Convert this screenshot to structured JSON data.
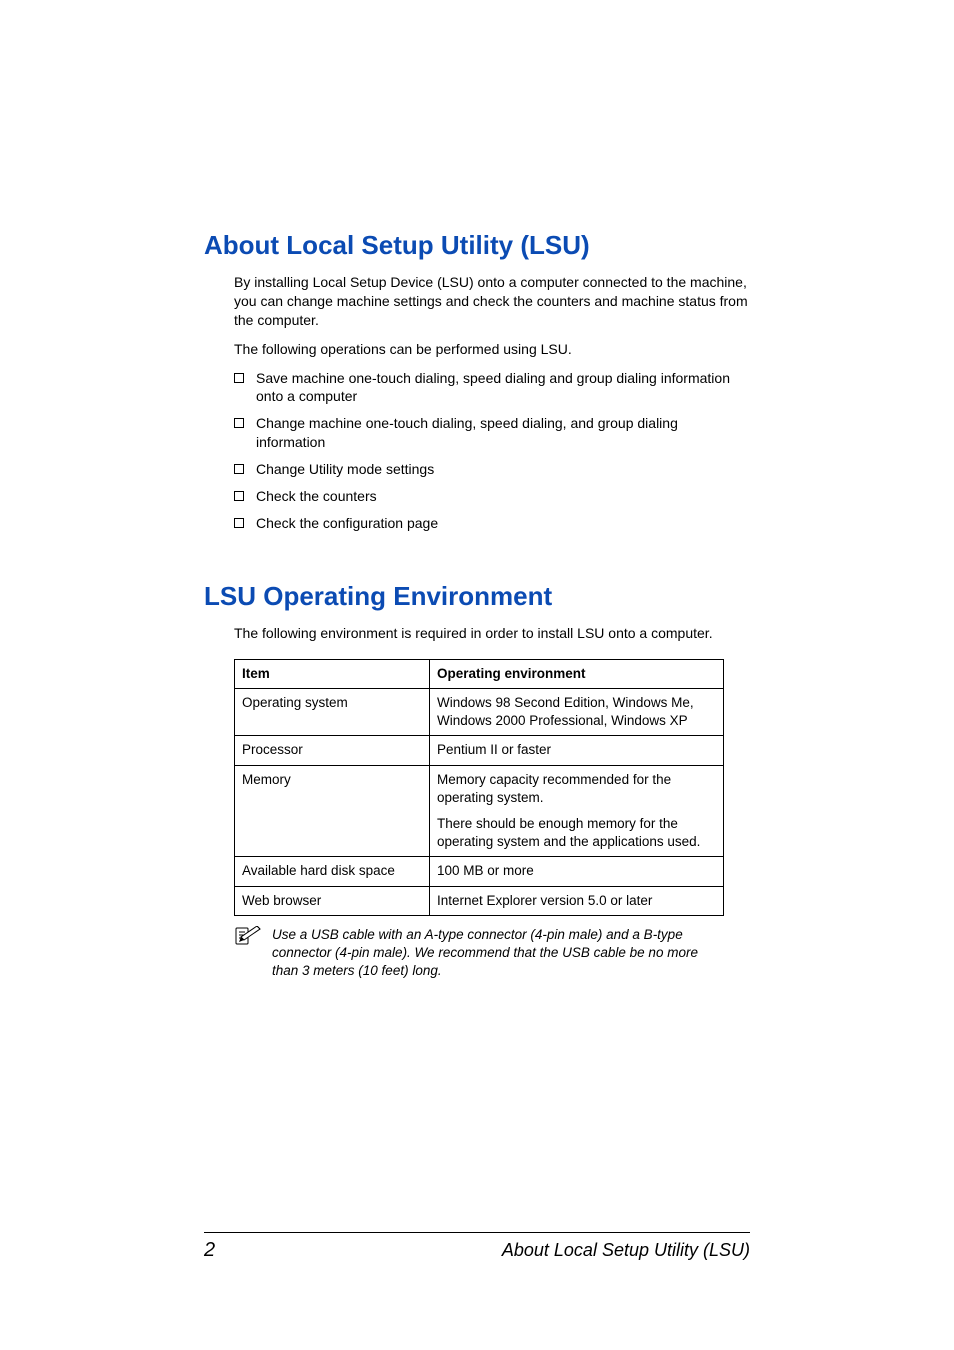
{
  "section1": {
    "heading": "About Local Setup Utility (LSU)",
    "intro": "By installing Local Setup Device (LSU) onto a computer connected to the machine, you can change machine settings and check the counters and machine status from the computer.",
    "lead": "The following operations can be performed using LSU.",
    "bullets": [
      "Save machine one-touch dialing, speed dialing and group dialing information onto a computer",
      "Change machine one-touch dialing, speed dialing, and group dialing information",
      "Change Utility mode settings",
      "Check the counters",
      "Check the configuration page"
    ]
  },
  "section2": {
    "heading": "LSU Operating Environment",
    "intro": "The following environment is required in order to install LSU onto a computer.",
    "table": {
      "headers": {
        "item": "Item",
        "env": "Operating environment"
      },
      "rows": [
        {
          "item": "Operating system",
          "env": "Windows 98 Second Edition, Windows Me, Windows 2000 Professional, Windows XP"
        },
        {
          "item": "Processor",
          "env": "Pentium II or faster"
        },
        {
          "item": "Memory",
          "env1": "Memory capacity recommended for the operating system.",
          "env2": "There should be enough memory for the operating system and the applications used."
        },
        {
          "item": "Available hard disk space",
          "env": "100 MB or more"
        },
        {
          "item": "Web browser",
          "env": "Internet Explorer version 5.0 or later"
        }
      ]
    },
    "note": "Use a USB cable with an A-type connector (4-pin male) and a B-type connector (4-pin male). We recommend that the USB cable be no more than 3 meters (10 feet) long."
  },
  "footer": {
    "page": "2",
    "title": "About Local Setup Utility (LSU)"
  }
}
